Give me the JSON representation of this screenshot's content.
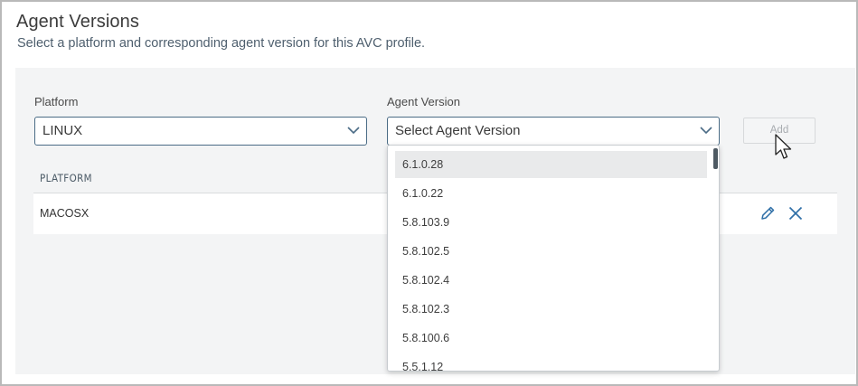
{
  "header": {
    "title": "Agent Versions",
    "subtitle": "Select a platform and corresponding agent version for this AVC profile."
  },
  "form": {
    "platform_label": "Platform",
    "platform_value": "LINUX",
    "agent_version_label": "Agent Version",
    "agent_version_placeholder": "Select Agent Version",
    "add_label": "Add"
  },
  "table": {
    "columns": [
      "PLATFORM"
    ],
    "rows": [
      {
        "platform": "MACOSX"
      }
    ]
  },
  "dropdown": {
    "options": [
      "6.1.0.28",
      "6.1.0.22",
      "5.8.103.9",
      "5.8.102.5",
      "5.8.102.4",
      "5.8.102.3",
      "5.8.100.6",
      "5.5.1.12"
    ],
    "highlighted_index": 0
  },
  "icons": {
    "chevron": "chevron-down-icon",
    "edit": "pencil-icon",
    "delete": "close-icon",
    "cursor": "mouse-pointer-icon"
  },
  "colors": {
    "accent": "#2f6fa7",
    "border": "#4b6c86",
    "panel_bg": "#f3f4f5",
    "highlight": "#e9eaeb"
  }
}
